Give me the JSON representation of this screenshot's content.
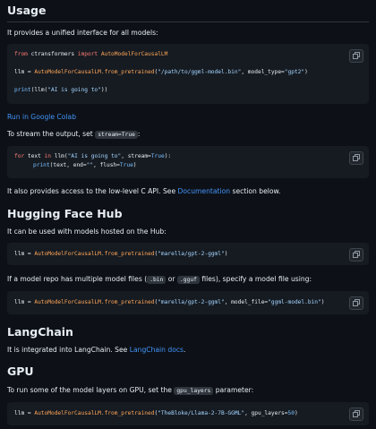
{
  "usage": {
    "heading": "Usage",
    "intro": "It provides a unified interface for all models:",
    "code": {
      "from_kw": "from",
      "pkg": " ctransformers ",
      "import_kw": "import",
      "cls": " AutoModelForCausalLM",
      "l2_var": "llm = ",
      "l2_call": "AutoModelForCausalLM.from_pretrained",
      "l2_open": "(",
      "l2_str": "\"/path/to/ggml-model.bin\"",
      "l2_mid": ", model_type=",
      "l2_str2": "\"gpt2\"",
      "l2_close": ")",
      "l3_fn": "print",
      "l3_mid": "(llm(",
      "l3_str": "\"AI is going to\"",
      "l3_close": "))"
    },
    "colab_link": "Run in Google Colab",
    "stream_pre": "To stream the output, set ",
    "stream_code": "stream=True",
    "stream_post": ":",
    "code2": {
      "for_kw": "for",
      "l1a": " text ",
      "in_kw": "in",
      "l1b": " llm(",
      "l1_str": "\"AI is going to\"",
      "l1c": ", stream=",
      "l1_true": "True",
      "l1d": "):",
      "l2_fn": "print",
      "l2a": "(text, end=",
      "l2_str": "\"\"",
      "l2b": ", flush=",
      "l2_true": "True",
      "l2c": ")"
    },
    "lowlevel_pre": "It also provides access to the low-level C API. See ",
    "lowlevel_link": "Documentation",
    "lowlevel_post": " section below."
  },
  "hf": {
    "heading": "Hugging Face Hub",
    "intro": "It can be used with models hosted on the Hub:",
    "code": {
      "var": "llm = ",
      "call": "AutoModelForCausalLM.from_pretrained",
      "open": "(",
      "str": "\"marella/gpt-2-ggml\"",
      "close": ")"
    },
    "multi_pre": "If a model repo has multiple model files (",
    "multi_code1": ".bin",
    "multi_or": " or ",
    "multi_code2": ".gguf",
    "multi_post": " files), specify a model file using:",
    "code2": {
      "var": "llm = ",
      "call": "AutoModelForCausalLM.from_pretrained",
      "open": "(",
      "str": "\"marella/gpt-2-ggml\"",
      "mid": ", model_file=",
      "str2": "\"ggml-model.bin\"",
      "close": ")"
    }
  },
  "langchain": {
    "heading": "LangChain",
    "text_pre": "It is integrated into LangChain. See ",
    "link": "LangChain docs",
    "text_post": "."
  },
  "gpu": {
    "heading": "GPU",
    "text_pre": "To run some of the model layers on GPU, set the ",
    "code_inline": "gpu_layers",
    "text_post": " parameter:",
    "code": {
      "var": "llm = ",
      "call": "AutoModelForCausalLM.from_pretrained",
      "open": "(",
      "str": "\"TheBloke/Llama-2-7B-GGML\"",
      "mid": ", gpu_layers=",
      "num": "50",
      "close": ")"
    }
  },
  "icons": {
    "copy": "copy-icon"
  },
  "colors": {
    "background": "#0d1117",
    "code_bg": "#161b22",
    "link": "#4493f8",
    "keyword": "#ff7b72",
    "string": "#a5d6ff",
    "class": "#ffa657",
    "function": "#d2a8ff"
  }
}
